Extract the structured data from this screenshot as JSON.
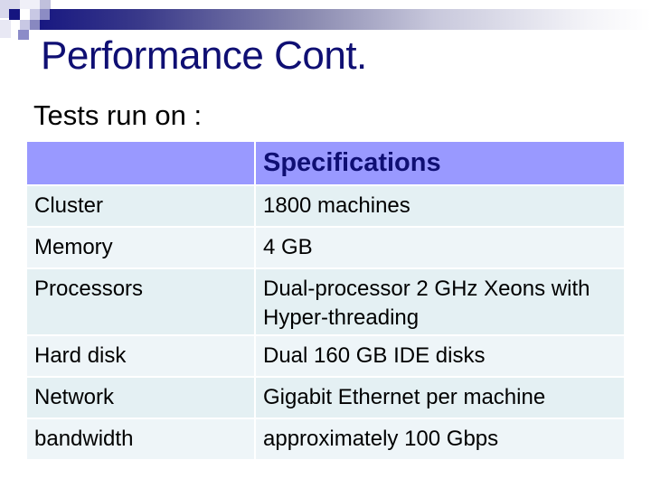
{
  "slide": {
    "title": "Performance Cont.",
    "subtitle": "Tests run on :",
    "accent_color": "#0f0f73",
    "header_bg": "#9999ff"
  },
  "table": {
    "headers": [
      "",
      "Specifications"
    ],
    "rows": [
      {
        "label": "Cluster",
        "value": "1800 machines"
      },
      {
        "label": "Memory",
        "value": "4 GB"
      },
      {
        "label": "Processors",
        "value": "Dual-processor 2 GHz Xeons with Hyper-threading"
      },
      {
        "label": "Hard disk",
        "value": "Dual 160 GB IDE disks"
      },
      {
        "label": "Network",
        "value": "Gigabit Ethernet per machine"
      },
      {
        "label": "bandwidth",
        "value": "approximately 100 Gbps"
      }
    ]
  }
}
